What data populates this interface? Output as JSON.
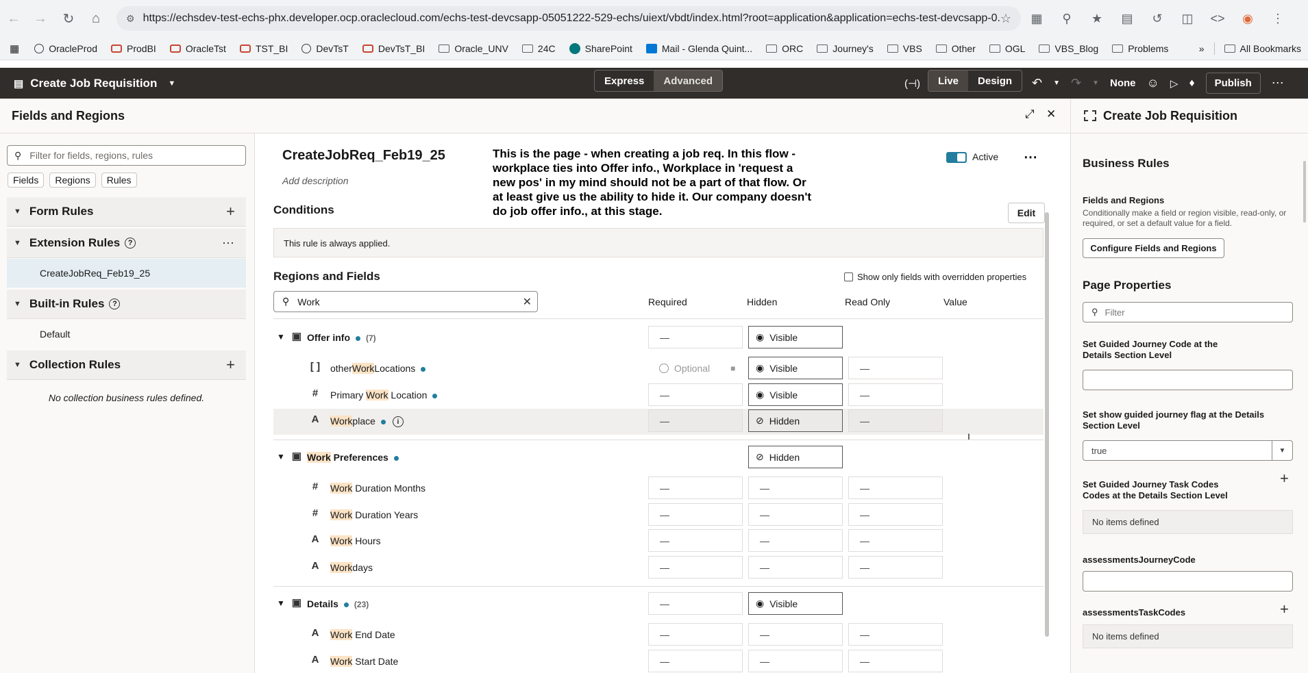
{
  "browser": {
    "url": "https://echsdev-test-echs-phx.developer.ocp.oraclecloud.com/echs-test-devcsapp-05051222-529-echs/uiext/vbdt/index.html?root=application&application=echs-test-devcsapp-0...",
    "bookmarks": [
      "OracleProd",
      "ProdBI",
      "OracleTst",
      "TST_BI",
      "DevTsT",
      "DevTsT_BI",
      "Oracle_UNV",
      "24C",
      "SharePoint",
      "Mail - Glenda Quint...",
      "ORC",
      "Journey's",
      "VBS",
      "Other",
      "OGL",
      "VBS_Blog",
      "Problems"
    ],
    "all_bookmarks": "All Bookmarks"
  },
  "appbar": {
    "title": "Create Job Requisition",
    "mode_express": "Express",
    "mode_advanced": "Advanced",
    "live": "Live",
    "design": "Design",
    "none": "None",
    "publish": "Publish"
  },
  "left": {
    "header": "Fields and Regions",
    "filter_placeholder": "Filter for fields, regions, rules",
    "chips": [
      "Fields",
      "Regions",
      "Rules"
    ],
    "form_rules": "Form Rules",
    "extension_rules": "Extension Rules",
    "ext_item": "CreateJobReq_Feb19_25",
    "builtin_rules": "Built-in Rules",
    "builtin_item": "Default",
    "collection_rules": "Collection Rules",
    "no_collection": "No collection business rules defined."
  },
  "middle": {
    "rule_name": "CreateJobReq_Feb19_25",
    "add_description": "Add description",
    "annotation": "This is the page - when creating a job req. In this flow - workplace ties into Offer info., Workplace in 'request a new pos' in my mind should not be a part of that flow.  Or at least give us the ability to hide it. Our company doesn't do job offer info., at this stage.",
    "active_label": "Active",
    "conditions": "Conditions",
    "edit": "Edit",
    "always_applied": "This rule is always applied.",
    "regions_fields": "Regions and Fields",
    "show_overridden": "Show only fields with overridden properties",
    "search_value": "Work",
    "columns": {
      "required": "Required",
      "hidden": "Hidden",
      "read_only": "Read Only",
      "value": "Value"
    },
    "dash": "—",
    "offer_info": {
      "pre": "",
      "hl": "",
      "post": "Offer info",
      "count": "(7)",
      "hidden": "Visible"
    },
    "other_work": {
      "pre": "other",
      "hl": "Work",
      "post": "Locations",
      "required": "Optional",
      "hidden": "Visible"
    },
    "primary_work": {
      "pre": "Primary ",
      "hl": "Work",
      "post": " Location",
      "hidden": "Visible"
    },
    "workplace": {
      "pre": "",
      "hl": "Work",
      "post": "place",
      "hidden": "Hidden"
    },
    "work_prefs": {
      "pre": "",
      "hl": "Work",
      "post": " Preferences",
      "hidden": "Hidden"
    },
    "duration_months": {
      "pre": "",
      "hl": "Work",
      "post": " Duration Months"
    },
    "duration_years": {
      "pre": "",
      "hl": "Work",
      "post": " Duration Years"
    },
    "work_hours": {
      "pre": "",
      "hl": "Work",
      "post": " Hours"
    },
    "workdays": {
      "pre": "",
      "hl": "Work",
      "post": "days"
    },
    "details": {
      "pre": "",
      "hl": "",
      "post": "Details",
      "count": "(23)",
      "hidden": "Visible"
    },
    "end_date": {
      "pre": "",
      "hl": "Work",
      "post": " End Date"
    },
    "start_date": {
      "pre": "",
      "hl": "Work",
      "post": " Start Date"
    }
  },
  "right": {
    "title": "Create Job Requisition",
    "business_rules": "Business Rules",
    "fields_regions": "Fields and Regions",
    "fields_regions_desc": "Conditionally make a field or region visible, read-only, or required, or set a default value for a field.",
    "configure": "Configure Fields and Regions",
    "page_properties": "Page Properties",
    "filter_placeholder": "Filter",
    "gj_code_label": "Set Guided Journey Code at the Details Section Level",
    "gj_flag_label": "Set show guided journey flag at the Details Section Level",
    "gj_flag_value": "true",
    "gj_task_label": "Set Guided Journey Task Codes Codes at the Details Section Level",
    "no_items": "No items defined",
    "assess_code": "assessmentsJourneyCode",
    "assess_tasks": "assessmentsTaskCodes"
  }
}
